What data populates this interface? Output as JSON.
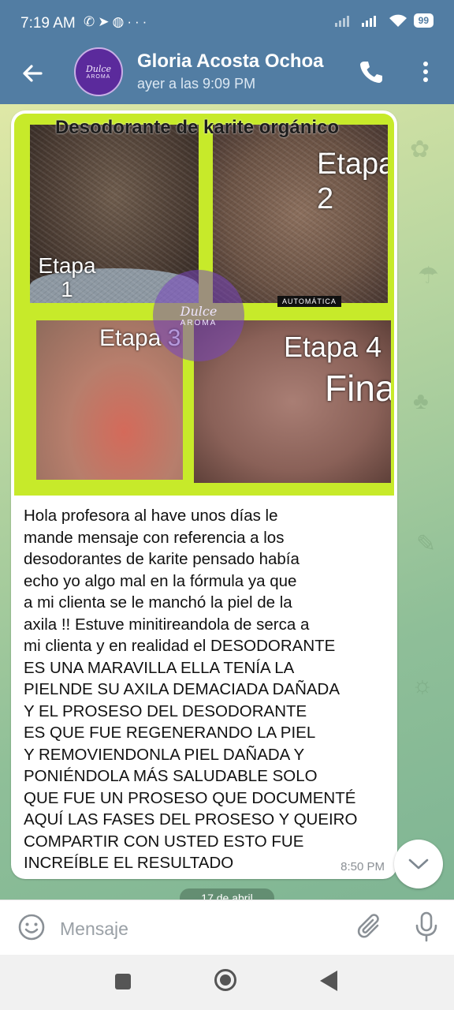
{
  "status_bar": {
    "time": "7:19 AM",
    "app_icons": [
      "whatsapp-icon",
      "telegram-icon",
      "messenger-icon",
      "more-icon"
    ],
    "battery": "99"
  },
  "header": {
    "contact_name": "Gloria Acosta Ochoa",
    "last_seen": "ayer a las 9:09 PM",
    "avatar_brand_line1": "Dulce",
    "avatar_brand_line2": "AROMA"
  },
  "message": {
    "image": {
      "title": "Desodorante de karite orgánico",
      "stage1": "Etapa\n1",
      "stage2": "Etapa 2",
      "stage3": "Etapa 3",
      "stage4": "Etapa 4",
      "stage4_final": "Final",
      "auto_tag": "AUTOMÁTICA",
      "watermark_line1": "Dulce",
      "watermark_line2": "AROMA"
    },
    "text": "Hola profesora al have unos días le\nmande mensaje con referencia a los\ndesodorantes de karite pensado había\necho yo algo mal en la fórmula ya que\na mi clienta se le manchó la piel de la\naxila !! Estuve minitireandola de serca a\nmi clienta  y en realidad el DESODORANTE\nES UNA MARAVILLA ELLA TENÍA LA\nPIELNDE SU AXILA DEMACIADA DAÑADA\nY EL PROSESO DEL DESODORANTE\nES QUE FUE REGENERANDO LA PIEL\nY REMOVIENDONLA PIEL DAÑADA Y\nPONIÉNDOLA MÁS SALUDABLE SOLO\nQUE FUE UN PROSESO QUE DOCUMENTÉ\nAQUÍ LAS FASES DEL PROSESO Y QUEIRO\nCOMPARTIR CON USTED ESTO FUE\nINCREÍBLE EL RESULTADO",
    "time": "8:50 PM"
  },
  "date_pill": "17 de abril",
  "input": {
    "placeholder": "Mensaje"
  },
  "colors": {
    "header_bg": "#527da3",
    "photo_border": "#c7ea2a"
  }
}
